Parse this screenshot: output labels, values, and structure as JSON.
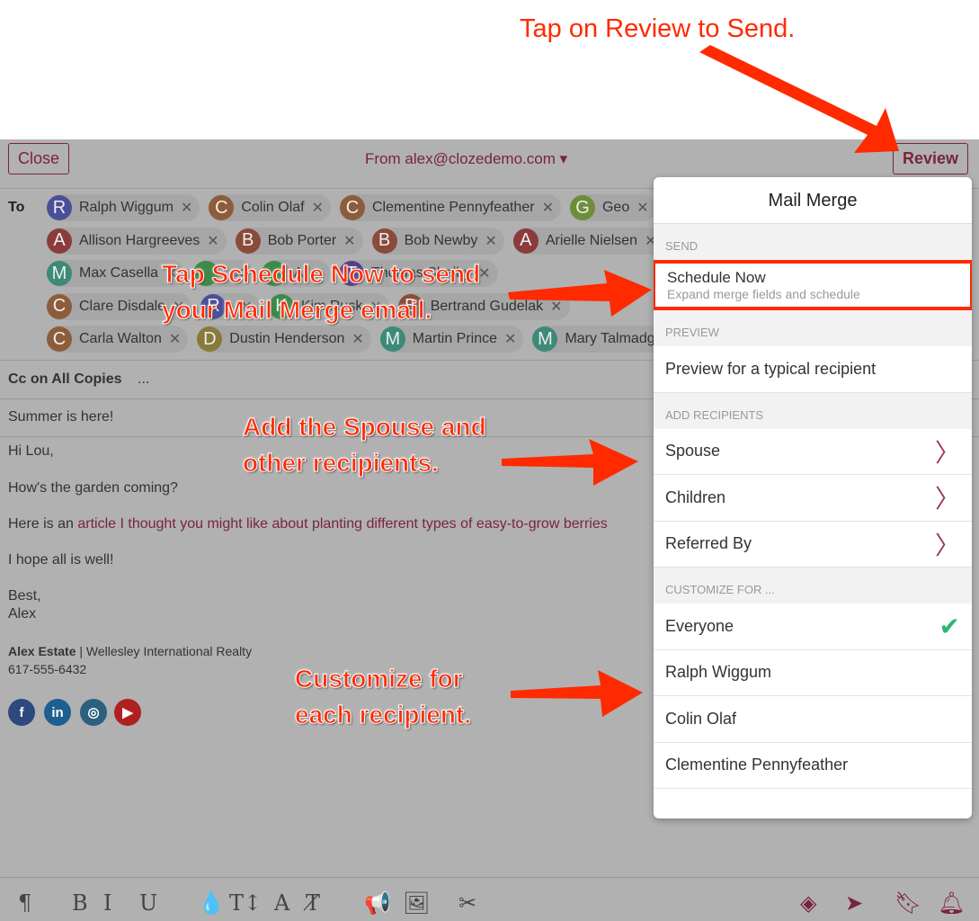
{
  "annotations": {
    "review": "Tap on Review to Send.",
    "schedule": "Tap Schedule Now to send your Mail Merge email.",
    "spouse": "Add the Spouse and other recipients.",
    "customize": "Customize for each recipient."
  },
  "header": {
    "close": "Close",
    "from": "From alex@clozedemo.com",
    "review": "Review"
  },
  "to_label": "To",
  "recipients": [
    [
      {
        "i": "R",
        "n": "Ralph Wiggum",
        "c": "#4b4f9a"
      },
      {
        "i": "C",
        "n": "Colin Olaf",
        "c": "#8d5c3a"
      },
      {
        "i": "C",
        "n": "Clementine Pennyfeather",
        "c": "#8d5c3a"
      },
      {
        "i": "G",
        "n": "Geo",
        "c": "#6d8d3b"
      }
    ],
    [
      {
        "i": "A",
        "n": "Allison Hargreeves",
        "c": "#8b3b3b"
      },
      {
        "i": "B",
        "n": "Bob Porter",
        "c": "#8a4b3a"
      },
      {
        "i": "B",
        "n": "Bob Newby",
        "c": "#8a4b3a"
      },
      {
        "i": "A",
        "n": "Arielle Nielsen",
        "c": "#8b3b3b"
      }
    ],
    [
      {
        "i": "M",
        "n": "Max Casella",
        "c": "#3c8a78"
      },
      {
        "i": "",
        "n": "",
        "c": "#3c8a4a"
      },
      {
        "i": "",
        "n": "A",
        "c": "#3c8a4a"
      },
      {
        "i": "T",
        "n": "Thomas Shelby",
        "c": "#5a3d8a"
      }
    ],
    [
      {
        "i": "C",
        "n": "Clare Disdale",
        "c": "#8d5c3a"
      },
      {
        "i": "R",
        "n": "",
        "c": "#4b4f9a"
      },
      {
        "i": "K",
        "n": "Kim Rusk",
        "c": "#3c8a4a"
      },
      {
        "i": "B",
        "n": "Bertrand Gudelak",
        "c": "#8a4b3a"
      }
    ],
    [
      {
        "i": "C",
        "n": "Carla Walton",
        "c": "#8d5c3a"
      },
      {
        "i": "D",
        "n": "Dustin Henderson",
        "c": "#8a7a3a"
      },
      {
        "i": "M",
        "n": "Martin Prince",
        "c": "#3c8a78"
      },
      {
        "i": "M",
        "n": "Mary Talmadge",
        "c": "#3c8a78"
      }
    ]
  ],
  "cc": {
    "label": "Cc on All Copies",
    "more": "..."
  },
  "subject": "Summer is here!",
  "body": {
    "greeting": "Hi Lou,",
    "line1": "How's the garden coming?",
    "line2_pre": "Here is an ",
    "line2_link": "article I thought you might like about planting different types of easy-to-grow berries",
    "line3": "I hope all is well!",
    "signoff": "Best,",
    "name": "Alex"
  },
  "signature": {
    "name": "Alex Estate",
    "company": "| Wellesley International Realty",
    "phone": "617-555-6432"
  },
  "social": [
    "facebook",
    "linkedin",
    "instagram",
    "youtube"
  ],
  "popover": {
    "title": "Mail Merge",
    "send": "SEND",
    "schedule": "Schedule Now",
    "schedule_sub": "Expand merge fields and schedule",
    "preview": "PREVIEW",
    "preview_item": "Preview for a typical recipient",
    "add": "ADD RECIPIENTS",
    "add_items": [
      "Spouse",
      "Children",
      "Referred By"
    ],
    "customize": "CUSTOMIZE FOR ...",
    "customize_items": [
      "Everyone",
      "Ralph Wiggum",
      "Colin Olaf",
      "Clementine Pennyfeather"
    ]
  },
  "toolbar": {
    "left": [
      "¶",
      "B",
      "I",
      "U",
      "💧",
      "T↕",
      "A",
      "T̸",
      "📢",
      "🖼",
      "✂"
    ]
  },
  "colors": {
    "accent": "#7a2340",
    "annotation": "#ff2a00",
    "check": "#2bb673"
  }
}
